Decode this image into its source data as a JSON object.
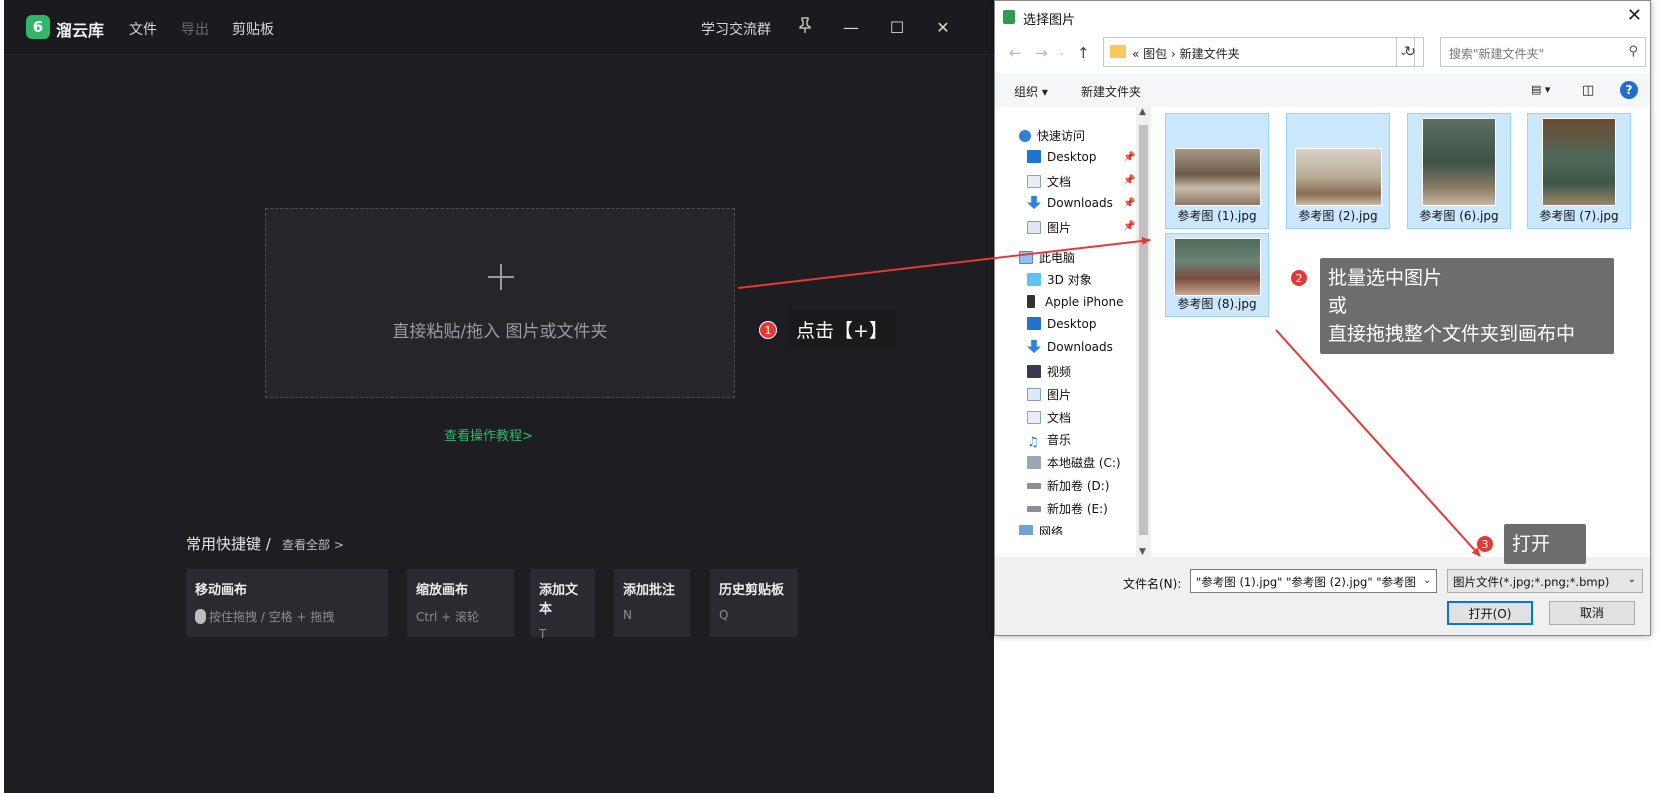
{
  "app": {
    "name": "溜云库",
    "logo_glyph": "6",
    "menu": [
      "文件",
      "导出",
      "剪贴板"
    ],
    "community": "学习交流群",
    "dropzone_text": "直接粘贴/拖入 图片或文件夹",
    "tutorial_link": "查看操作教程>",
    "shortcuts_title": "常用快捷键 /",
    "shortcuts_all": "查看全部 >",
    "shortcuts": [
      {
        "name": "移动画布",
        "key": "按住拖拽  / 空格 +  拖拽"
      },
      {
        "name": "缩放画布",
        "key": "Ctrl +  滚轮"
      },
      {
        "name": "添加文本",
        "key": "T"
      },
      {
        "name": "添加批注",
        "key": "N"
      },
      {
        "name": "历史剪贴板",
        "key": "Q"
      }
    ]
  },
  "annotations": {
    "step1_num": "1",
    "step1_text": "点击【+】",
    "step2_num": "2",
    "step2_lines": [
      "批量选中图片",
      "或",
      "直接拖拽整个文件夹到画布中"
    ],
    "step3_num": "3",
    "step3_text": "打开",
    "color": "#e53935"
  },
  "dialog": {
    "title": "选择图片",
    "address": "«  图包  ›  新建文件夹",
    "search_placeholder": "搜索\"新建文件夹\"",
    "toolbar_organize": "组织 ▾",
    "toolbar_new_folder": "新建文件夹",
    "tree": {
      "quick_access": "快速访问",
      "quick_items": [
        "Desktop",
        "文档",
        "Downloads",
        "图片"
      ],
      "this_pc": "此电脑",
      "pc_items": [
        "3D 对象",
        "Apple iPhone",
        "Desktop",
        "Downloads",
        "视频",
        "图片",
        "文档",
        "音乐",
        "本地磁盘 (C:)",
        "新加卷 (D:)",
        "新加卷 (E:)"
      ],
      "network": "网络"
    },
    "files": [
      "参考图 (1).jpg",
      "参考图 (2).jpg",
      "参考图 (6).jpg",
      "参考图 (7).jpg",
      "参考图 (8).jpg"
    ],
    "filename_label": "文件名(N):",
    "filename_value": "\"参考图 (1).jpg\" \"参考图 (2).jpg\" \"参考图",
    "filter_value": "图片文件(*.jpg;*.png;*.bmp)",
    "open_button": "打开(O)",
    "cancel_button": "取消"
  }
}
